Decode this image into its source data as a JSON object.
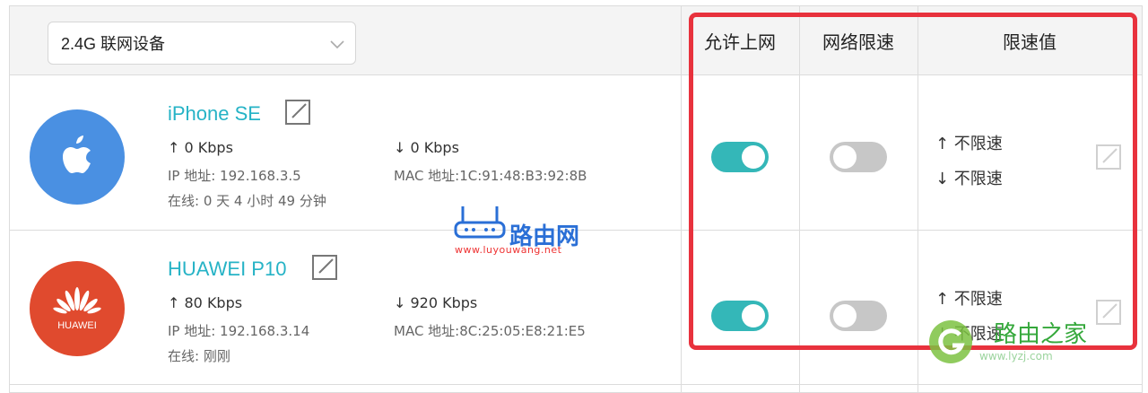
{
  "band_select": {
    "value": "2.4G 联网设备"
  },
  "columns": {
    "internet": "允许上网",
    "speed_limit": "网络限速",
    "limit_value": "限速值"
  },
  "devices": [
    {
      "name": "iPhone SE",
      "brand": "apple",
      "up": "↑ 0 Kbps",
      "down": "↓ 0 Kbps",
      "ip": "IP 地址: 192.168.3.5",
      "mac": "MAC 地址:1C:91:48:B3:92:8B",
      "online": "在线: 0 天 4 小时 49 分钟",
      "internet_allowed": true,
      "speed_limited": false,
      "limit_up": "↑ 不限速",
      "limit_down": "↓ 不限速"
    },
    {
      "name": "HUAWEI P10",
      "brand": "huawei",
      "brand_label": "HUAWEI",
      "up": "↑ 80 Kbps",
      "down": "↓ 920 Kbps",
      "ip": "IP 地址: 192.168.3.14",
      "mac": "MAC 地址:8C:25:05:E8:21:E5",
      "online": "在线: 刚刚",
      "internet_allowed": true,
      "speed_limited": false,
      "limit_up": "↑ 不限速",
      "limit_down": "↓ 不限速"
    }
  ],
  "watermarks": {
    "luyouwang_text": "路由网",
    "luyouwang_url": "www.luyouwang.net",
    "lyzj_text": "路由之家",
    "lyzj_url": "www.lyzj.com"
  },
  "colors": {
    "accent": "#26b3c6",
    "toggle_on": "#34b7b8",
    "toggle_off": "#c7c7c7",
    "highlight": "#e8323d",
    "apple_blue": "#4a90e2",
    "huawei_red": "#e04a2e"
  }
}
